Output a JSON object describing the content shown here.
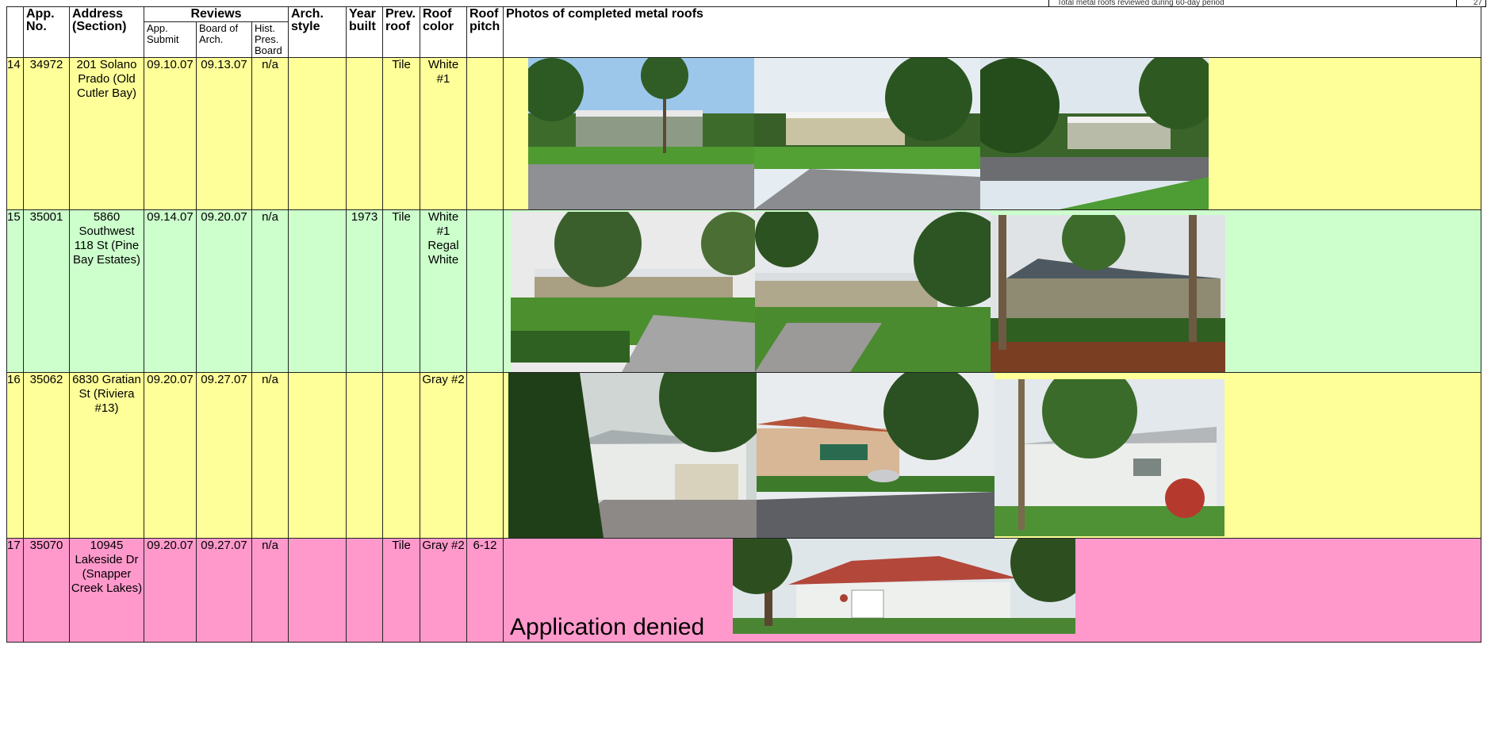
{
  "page_note": {
    "text": "Total metal roofs reviewed during 60-day period",
    "count": "27"
  },
  "headers": {
    "row_no": "",
    "app_no": "App. No.",
    "address": "Address (Section)",
    "reviews": "Reviews",
    "app_submit": "App. Submit",
    "board_arch": "Board of Arch.",
    "hist_pres": "Hist. Pres. Board",
    "arch_style": "Arch. style",
    "year_built": "Year built",
    "prev_roof": "Prev. roof",
    "roof_color": "Roof color",
    "roof_pitch": "Roof pitch",
    "photos": "Photos of completed metal roofs"
  },
  "rows": [
    {
      "num": "14",
      "app": "34972",
      "address": "201 Solano Prado (Old Cutler Bay)",
      "submit": "09.10.07",
      "board": "09.13.07",
      "hist": "n/a",
      "style": "",
      "year": "",
      "prev": "Tile",
      "color": "White #1",
      "pitch": ""
    },
    {
      "num": "15",
      "app": "35001",
      "address": "5860 Southwest 118 St (Pine Bay Estates)",
      "submit": "09.14.07",
      "board": "09.20.07",
      "hist": "n/a",
      "style": "",
      "year": "1973",
      "prev": "Tile",
      "color": "White #1 Regal White",
      "pitch": ""
    },
    {
      "num": "16",
      "app": "35062",
      "address": "6830 Gratian St (Riviera #13)",
      "submit": "09.20.07",
      "board": "09.27.07",
      "hist": "n/a",
      "style": "",
      "year": "",
      "prev": "",
      "color": "Gray #2",
      "pitch": ""
    },
    {
      "num": "17",
      "app": "35070",
      "address": "10945 Lakeside Dr (Snapper Creek Lakes)",
      "submit": "09.20.07",
      "board": "09.27.07",
      "hist": "n/a",
      "style": "",
      "year": "",
      "prev": "Tile",
      "color": "Gray #2",
      "pitch": "6-12",
      "note": "Application denied"
    }
  ]
}
